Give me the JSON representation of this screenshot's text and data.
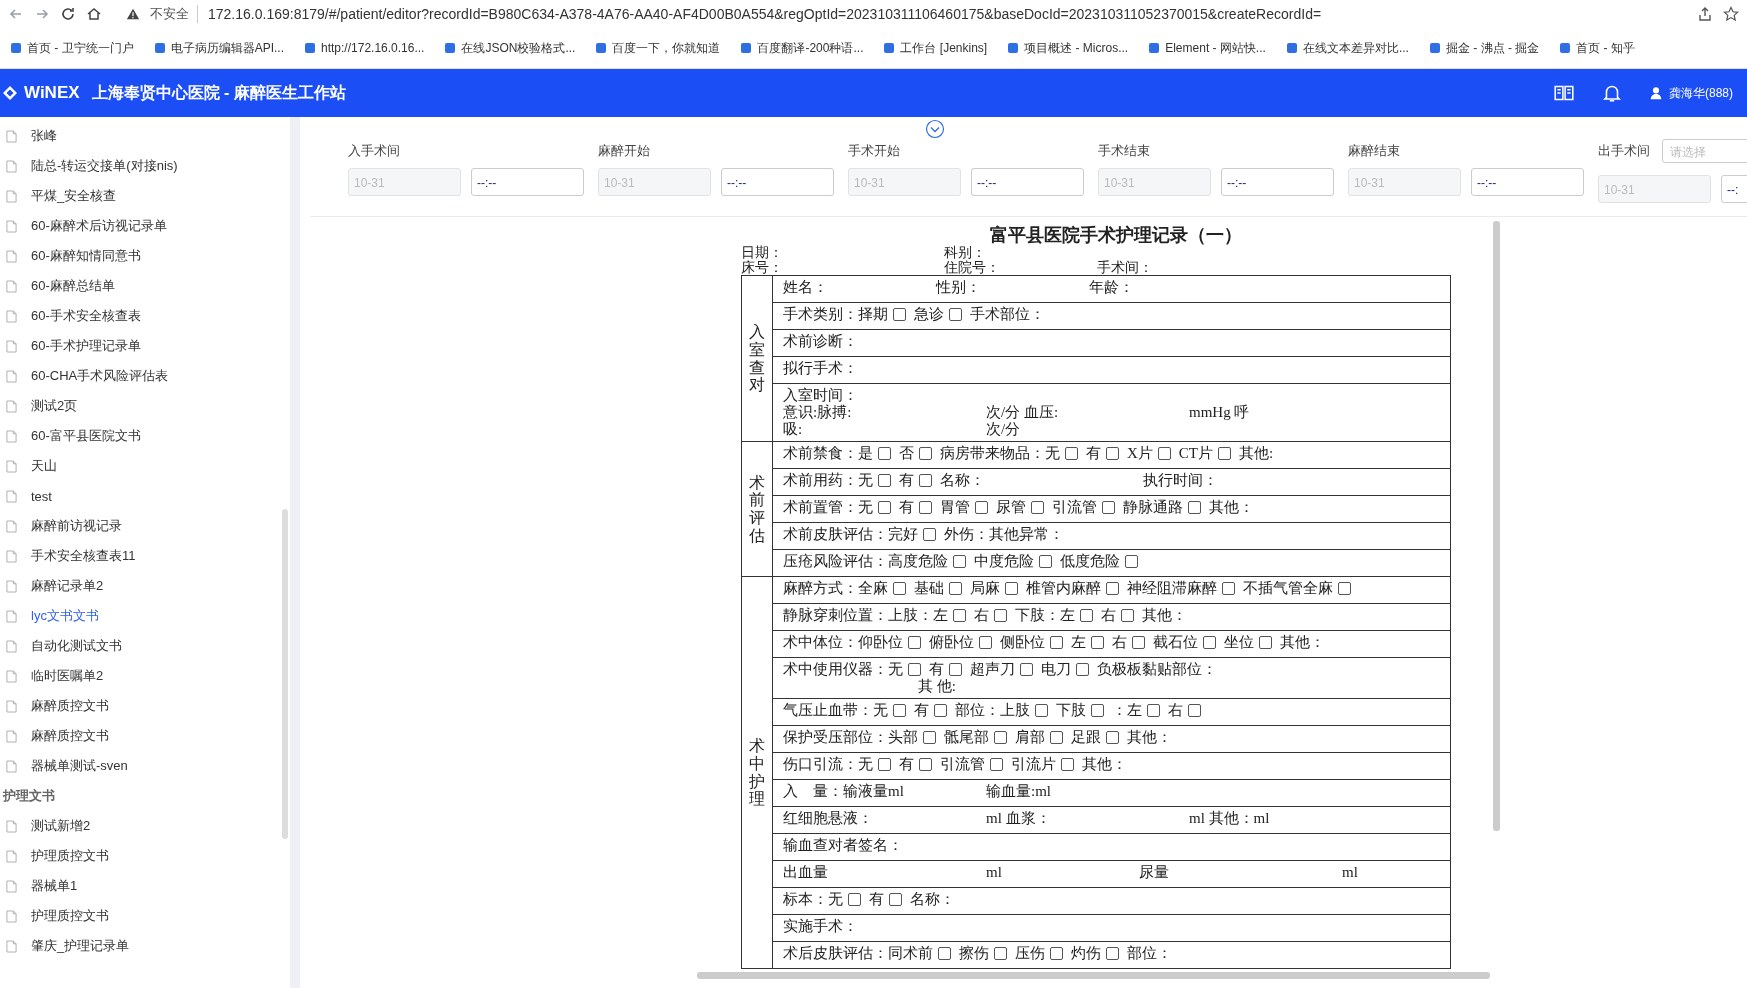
{
  "browser": {
    "security": "不安全",
    "url": "172.16.0.169:8179/#/patient/editor?recordId=B980C634-A378-4A76-AA40-AF4D00B0A554&regOptId=202310311106460175&baseDocId=202310311052370015&createRecordId=",
    "bookmarks": [
      "首页 - 卫宁统一门户",
      "电子病历编辑器API...",
      "http://172.16.0.16...",
      "在线JSON校验格式...",
      "百度一下，你就知道",
      "百度翻译-200种语...",
      "工作台 [Jenkins]",
      "项目概述 - Micros...",
      "Element - 网站快...",
      "在线文本差异对比...",
      "掘金 - 沸点 - 掘金",
      "首页 - 知乎"
    ]
  },
  "header": {
    "logo": "WiNEX",
    "title": "上海奉贤中心医院 - 麻醉医生工作站",
    "user": "龚海华(888)"
  },
  "sidebar": {
    "items": [
      {
        "kind": "doc",
        "label": "张峰",
        "selected": false
      },
      {
        "kind": "doc",
        "label": "陆总-转运交接单(对接nis)",
        "selected": false
      },
      {
        "kind": "doc",
        "label": "平煤_安全核查",
        "selected": false
      },
      {
        "kind": "doc",
        "label": "60-麻醉术后访视记录单",
        "selected": false
      },
      {
        "kind": "doc",
        "label": "60-麻醉知情同意书",
        "selected": false
      },
      {
        "kind": "doc",
        "label": "60-麻醉总结单",
        "selected": false
      },
      {
        "kind": "doc",
        "label": "60-手术安全核查表",
        "selected": false
      },
      {
        "kind": "doc",
        "label": "60-手术护理记录单",
        "selected": false
      },
      {
        "kind": "doc",
        "label": "60-CHA手术风险评估表",
        "selected": false
      },
      {
        "kind": "doc",
        "label": "测试2页",
        "selected": false
      },
      {
        "kind": "doc",
        "label": "60-富平县医院文书",
        "selected": false
      },
      {
        "kind": "doc",
        "label": "天山",
        "selected": false
      },
      {
        "kind": "doc",
        "label": "test",
        "selected": false
      },
      {
        "kind": "doc",
        "label": "麻醉前访视记录",
        "selected": false
      },
      {
        "kind": "doc",
        "label": "手术安全核查表11",
        "selected": false
      },
      {
        "kind": "doc",
        "label": "麻醉记录单2",
        "selected": false
      },
      {
        "kind": "doc",
        "label": "lyc文书文书",
        "selected": true
      },
      {
        "kind": "doc",
        "label": "自动化测试文书",
        "selected": false
      },
      {
        "kind": "doc",
        "label": "临时医嘱单2",
        "selected": false
      },
      {
        "kind": "doc",
        "label": "麻醉质控文书",
        "selected": false
      },
      {
        "kind": "doc",
        "label": "麻醉质控文书",
        "selected": false
      },
      {
        "kind": "doc",
        "label": "器械单测试-sven",
        "selected": false
      },
      {
        "kind": "group",
        "label": "护理文书"
      },
      {
        "kind": "doc",
        "label": "测试新增2",
        "selected": false
      },
      {
        "kind": "doc",
        "label": "护理质控文书",
        "selected": false
      },
      {
        "kind": "doc",
        "label": "器械单1",
        "selected": false
      },
      {
        "kind": "doc",
        "label": "护理质控文书",
        "selected": false
      },
      {
        "kind": "doc",
        "label": "肇庆_护理记录单",
        "selected": false
      }
    ]
  },
  "times": [
    {
      "label": "入手术间",
      "date": "10-31",
      "time": "--:--"
    },
    {
      "label": "麻醉开始",
      "date": "10-31",
      "time": "--:--"
    },
    {
      "label": "手术开始",
      "date": "10-31",
      "time": "--:--"
    },
    {
      "label": "手术结束",
      "date": "10-31",
      "time": "--:--"
    },
    {
      "label": "麻醉结束",
      "date": "10-31",
      "time": "--:--"
    },
    {
      "label": "出手术间",
      "placeholder": "请选择",
      "date": "10-31",
      "time": "--:"
    }
  ],
  "document": {
    "title": "富平县医院手术护理记录（一）",
    "meta": [
      [
        {
          "text": "日期：",
          "kind": "wide"
        },
        {
          "text": "科别："
        }
      ],
      [
        {
          "text": "床号：",
          "kind": "wide"
        },
        {
          "text": "住院号：",
          "kind": "blank"
        },
        {
          "text": "手术间："
        }
      ]
    ],
    "sections": [
      {
        "label": "入室查对",
        "rows": [
          {
            "lines": [
              [
                {
                  "text": "姓名：",
                  "kind": "blank"
                },
                {
                  "text": "性别：",
                  "kind": "blank"
                },
                {
                  "text": "年龄："
                }
              ]
            ]
          },
          {
            "lines": [
              [
                {
                  "text": "手术类别：择期",
                  "checked": false
                },
                {
                  "text": "急诊",
                  "checked": false
                },
                {
                  "text": "手术部位："
                }
              ]
            ]
          },
          {
            "lines": [
              [
                {
                  "text": "术前诊断："
                }
              ]
            ]
          },
          {
            "lines": [
              [
                {
                  "text": "拟行手术："
                }
              ]
            ]
          },
          {
            "lines": [
              [
                {
                  "text": "入室时间："
                }
              ],
              [
                {
                  "text": "意识:脉搏:",
                  "kind": "wide"
                },
                {
                  "text": "次/分 血压:",
                  "kind": "wide"
                },
                {
                  "text": "mmHg 呼"
                }
              ],
              [
                {
                  "text": "吸:",
                  "kind": "wide"
                },
                {
                  "text": "次/分"
                }
              ]
            ]
          }
        ]
      },
      {
        "label": "术前评估",
        "rows": [
          {
            "lines": [
              [
                {
                  "text": "术前禁食：是",
                  "checked": false
                },
                {
                  "text": "否",
                  "checked": false
                },
                {
                  "text": "病房带来物品：无",
                  "checked": false
                },
                {
                  "text": "有",
                  "checked": false
                },
                {
                  "text": "X片",
                  "checked": false
                },
                {
                  "text": "CT片",
                  "checked": false
                },
                {
                  "text": "其他:"
                }
              ]
            ]
          },
          {
            "lines": [
              [
                {
                  "text": "术前用药：无",
                  "checked": false
                },
                {
                  "text": "有",
                  "checked": false
                },
                {
                  "text": "名称：",
                  "kind": "wide"
                },
                {
                  "text": "执行时间："
                }
              ]
            ]
          },
          {
            "lines": [
              [
                {
                  "text": "术前置管：无",
                  "checked": false
                },
                {
                  "text": "有",
                  "checked": false
                },
                {
                  "text": "胃管",
                  "checked": false
                },
                {
                  "text": "尿管",
                  "checked": false
                },
                {
                  "text": "引流管",
                  "checked": false
                },
                {
                  "text": "静脉通路",
                  "checked": false
                },
                {
                  "text": "其他："
                }
              ]
            ]
          },
          {
            "lines": [
              [
                {
                  "text": "术前皮肤评估：完好",
                  "checked": false
                },
                {
                  "text": "外伤：其他异常："
                }
              ]
            ]
          },
          {
            "lines": [
              [
                {
                  "text": "压疮风险评估：高度危险",
                  "checked": false
                },
                {
                  "text": "中度危险",
                  "checked": false
                },
                {
                  "text": "低度危险",
                  "checked": false
                }
              ]
            ]
          }
        ]
      },
      {
        "label": "术中护理",
        "rows": [
          {
            "lines": [
              [
                {
                  "text": "麻醉方式：全麻",
                  "checked": false
                },
                {
                  "text": "基础",
                  "checked": false
                },
                {
                  "text": "局麻",
                  "checked": false
                },
                {
                  "text": "椎管内麻醉",
                  "checked": false
                },
                {
                  "text": "神经阻滞麻醉",
                  "checked": false
                },
                {
                  "text": "不插气管全麻",
                  "checked": false
                }
              ]
            ]
          },
          {
            "lines": [
              [
                {
                  "text": "静脉穿刺位置：上肢：左",
                  "checked": false
                },
                {
                  "text": "右",
                  "checked": false
                },
                {
                  "text": "下肢：左",
                  "checked": false
                },
                {
                  "text": "右",
                  "checked": false
                },
                {
                  "text": "其他："
                }
              ]
            ]
          },
          {
            "lines": [
              [
                {
                  "text": "术中体位：仰卧位",
                  "checked": false
                },
                {
                  "text": "俯卧位",
                  "checked": false
                },
                {
                  "text": "侧卧位",
                  "checked": false
                },
                {
                  "text": "左",
                  "checked": false
                },
                {
                  "text": "右",
                  "checked": false
                },
                {
                  "text": "截石位",
                  "checked": false
                },
                {
                  "text": "坐位",
                  "checked": false
                },
                {
                  "text": "其他："
                }
              ]
            ]
          },
          {
            "lines": [
              [
                {
                  "text": "术中使用仪器：无",
                  "checked": false
                },
                {
                  "text": "有",
                  "checked": false
                },
                {
                  "text": "超声刀",
                  "checked": false
                },
                {
                  "text": "电刀",
                  "checked": false
                },
                {
                  "text": "负极板黏贴部位："
                }
              ],
              [
                {
                  "text": "其 他:",
                  "kind": "indent"
                }
              ]
            ]
          },
          {
            "lines": [
              [
                {
                  "text": "气压止血带：无",
                  "checked": false
                },
                {
                  "text": "有",
                  "checked": false
                },
                {
                  "text": "部位：上肢",
                  "checked": false
                },
                {
                  "text": "下肢",
                  "checked": false
                },
                {
                  "text": "：左",
                  "checked": false
                },
                {
                  "text": "右",
                  "checked": false
                }
              ]
            ]
          },
          {
            "lines": [
              [
                {
                  "text": "保护受压部位：头部",
                  "checked": false
                },
                {
                  "text": "骶尾部",
                  "checked": false
                },
                {
                  "text": "肩部",
                  "checked": false
                },
                {
                  "text": "足跟",
                  "checked": false
                },
                {
                  "text": "其他："
                }
              ]
            ]
          },
          {
            "lines": [
              [
                {
                  "text": "伤口引流：无",
                  "checked": false
                },
                {
                  "text": "有",
                  "checked": false
                },
                {
                  "text": "引流管",
                  "checked": false
                },
                {
                  "text": "引流片",
                  "checked": false
                },
                {
                  "text": "其他："
                }
              ]
            ]
          },
          {
            "lines": [
              [
                {
                  "text": "入　量：输液量ml",
                  "kind": "wide"
                },
                {
                  "text": "输血量:ml"
                }
              ]
            ]
          },
          {
            "lines": [
              [
                {
                  "text": "红细胞悬液：",
                  "kind": "wide"
                },
                {
                  "text": "ml 血浆：",
                  "kind": "wide"
                },
                {
                  "text": "ml 其他：ml"
                }
              ]
            ]
          },
          {
            "lines": [
              [
                {
                  "text": "输血查对者签名："
                }
              ]
            ]
          },
          {
            "lines": [
              [
                {
                  "text": "出血量",
                  "kind": "wide"
                },
                {
                  "text": "ml",
                  "kind": "blank"
                },
                {
                  "text": "尿量",
                  "kind": "wide"
                },
                {
                  "text": "ml"
                }
              ]
            ]
          },
          {
            "lines": [
              [
                {
                  "text": "标本：无",
                  "checked": false
                },
                {
                  "text": "有",
                  "checked": false
                },
                {
                  "text": "名称："
                }
              ]
            ]
          },
          {
            "lines": [
              [
                {
                  "text": "实施手术："
                }
              ]
            ]
          },
          {
            "lines": [
              [
                {
                  "text": "术后皮肤评估：同术前",
                  "checked": false
                },
                {
                  "text": "擦伤",
                  "checked": false
                },
                {
                  "text": "压伤",
                  "checked": false
                },
                {
                  "text": "灼伤",
                  "checked": false
                },
                {
                  "text": "部位："
                }
              ]
            ]
          }
        ]
      }
    ]
  }
}
